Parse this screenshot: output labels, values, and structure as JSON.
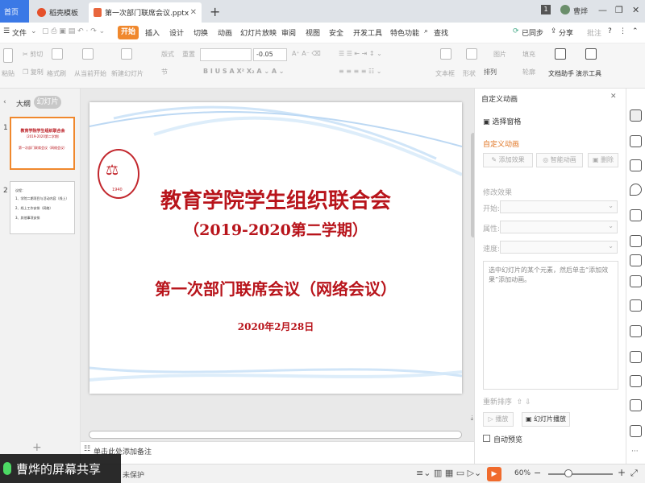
{
  "tabs": {
    "home": "首页",
    "template": "稻壳模板",
    "document": "第一次部门联席会议.pptx"
  },
  "user": {
    "badge": "1",
    "name": "曹烨"
  },
  "menu": {
    "file": "文件",
    "items": [
      "开始",
      "插入",
      "设计",
      "切换",
      "动画",
      "幻灯片放映",
      "审阅",
      "视图",
      "安全",
      "开发工具",
      "特色功能"
    ],
    "search": "查找",
    "sync": "已同步",
    "share": "分享",
    "comment": "批注",
    "help": "?"
  },
  "ribbon": {
    "paste": "粘贴",
    "cut": "剪切",
    "copy": "复制",
    "format_painter": "格式刷",
    "from_start": "从当前开始",
    "new_slide": "新建幻灯片",
    "layout": "版式",
    "section": "节",
    "reset": "重置",
    "font_size": "-0.05",
    "textbox": "文本框",
    "shape": "形状",
    "arrange": "排列",
    "image": "图片",
    "fill": "填充",
    "outline": "轮廓",
    "doc_assistant": "文档助手",
    "presenter": "演示工具"
  },
  "left_panel": {
    "outline": "大纲",
    "slides": "幻灯片",
    "slide_nums": [
      "1",
      "2"
    ],
    "add": "+"
  },
  "slide": {
    "title": "教育学院学生组织联合会",
    "subtitle": "（2019-2020第二学期）",
    "meeting": "第一次部门联席会议（网络会议）",
    "date": "2020年2月28日",
    "seal_year": "1940"
  },
  "thumb1": {
    "l1": "教育学院学生组织联合会",
    "l2": "（2019-2020第二学期）",
    "l3": "第一次部门联席会议（网络会议）"
  },
  "thumb2": {
    "l1": "议程：",
    "l2": "1、学院二期项目与活动内容（线上）",
    "l3": "2、线上工作安排（网络）",
    "l4": "3、其他事项安排"
  },
  "notes": "单击此处添加备注",
  "right_panel": {
    "header": "自定义动画",
    "select_pane": "选择窗格",
    "section_title": "自定义动画",
    "add_effect": "添加效果",
    "smart_anim": "智能动画",
    "delete": "删除",
    "modify": "修改效果",
    "start": "开始:",
    "property": "属性:",
    "speed": "速度:",
    "hint": "选中幻灯片的某个元素，然后单击“添加效果”添加动画。",
    "reorder": "重新排序",
    "play": "播放",
    "slideshow": "幻灯片播放",
    "auto_preview": "自动预览"
  },
  "status": {
    "share_label": "曹烨的屏幕共享",
    "protect": "未保护",
    "zoom": "60%",
    "minus": "−",
    "plus": "+"
  }
}
